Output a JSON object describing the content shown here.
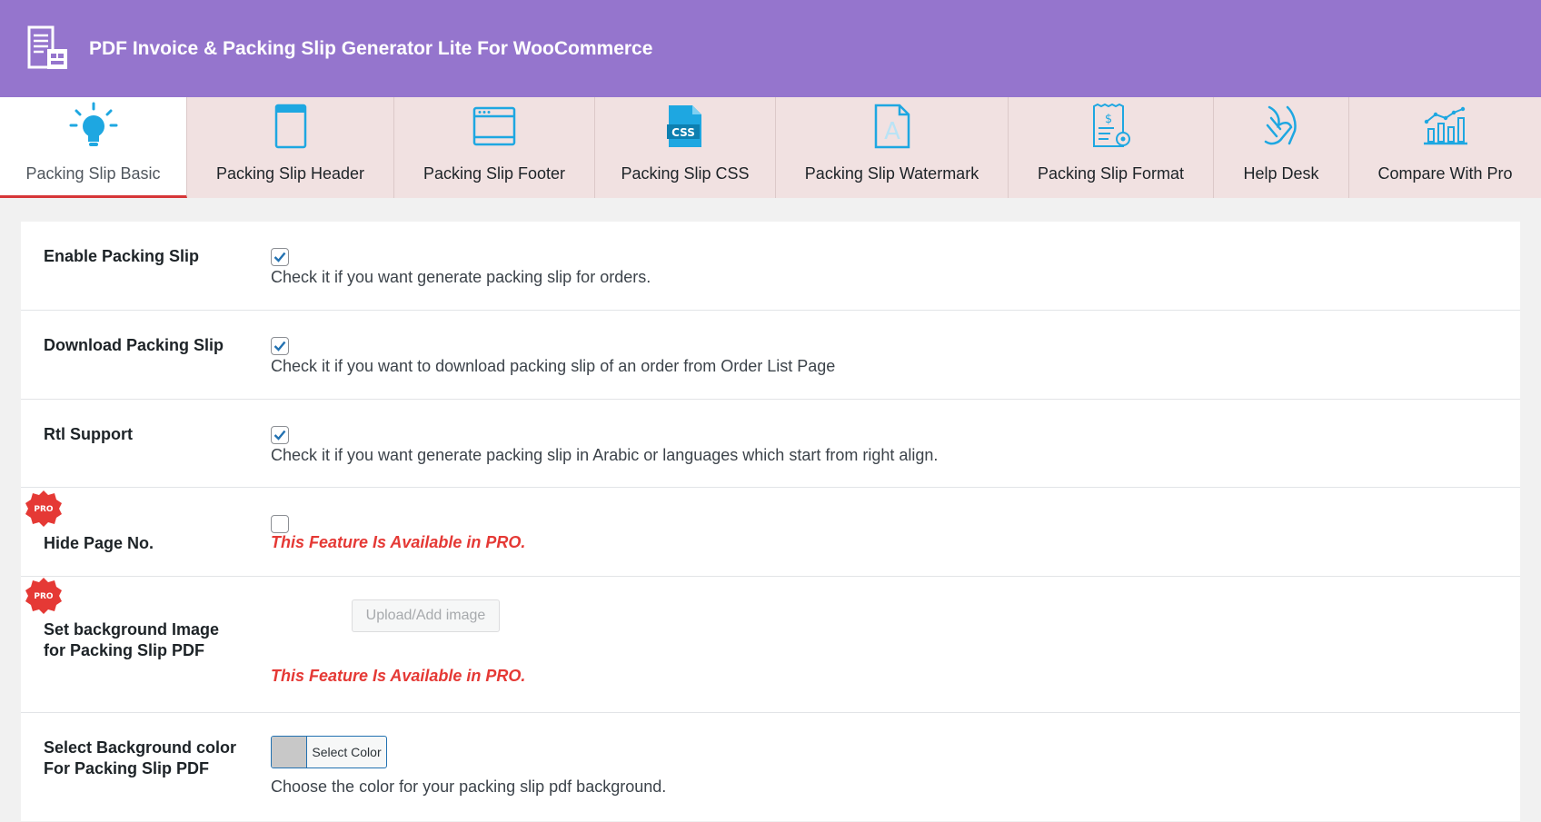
{
  "header": {
    "title": "PDF Invoice & Packing Slip Generator Lite For WooCommerce",
    "logo_icon": "invoice-logo-icon"
  },
  "tabs": [
    {
      "label": "Packing Slip Basic",
      "icon": "lightbulb-icon",
      "active": true
    },
    {
      "label": "Packing Slip Header",
      "icon": "document-header-icon"
    },
    {
      "label": "Packing Slip Footer",
      "icon": "browser-window-icon"
    },
    {
      "label": "Packing Slip CSS",
      "icon": "css-file-icon"
    },
    {
      "label": "Packing Slip Watermark",
      "icon": "watermark-file-icon"
    },
    {
      "label": "Packing Slip Format",
      "icon": "receipt-gear-icon"
    },
    {
      "label": "Help Desk",
      "icon": "helping-hand-icon"
    },
    {
      "label": "Compare With Pro",
      "icon": "chart-compare-icon"
    }
  ],
  "settings": {
    "enable": {
      "label": "Enable Packing Slip",
      "checked": true,
      "desc": "Check it if you want generate packing slip for orders."
    },
    "download": {
      "label": "Download Packing Slip",
      "checked": true,
      "desc": "Check it if you want to download packing slip of an order from Order List Page"
    },
    "rtl": {
      "label": "Rtl Support",
      "checked": true,
      "desc": "Check it if you want generate packing slip in Arabic or languages which start from right align."
    },
    "hide_page": {
      "label": "Hide Page No.",
      "checked": false,
      "pro_msg": "This Feature Is Available in PRO.",
      "badge": "PRO"
    },
    "bg_image": {
      "label_line1": "Set background Image",
      "label_line2": "for Packing Slip PDF",
      "button": "Upload/Add image",
      "pro_msg": "This Feature Is Available in PRO.",
      "badge": "PRO"
    },
    "bg_color": {
      "label_line1": "Select Background color",
      "label_line2": "For Packing Slip PDF",
      "button": "Select Color",
      "swatch": "#c8c8c8",
      "desc": "Choose the color for your packing slip pdf background."
    }
  },
  "colors": {
    "header_bg": "#9575cd",
    "tab_bg": "#f1e1e1",
    "icon_blue": "#1ea7e1",
    "pro_red": "#e53935"
  }
}
